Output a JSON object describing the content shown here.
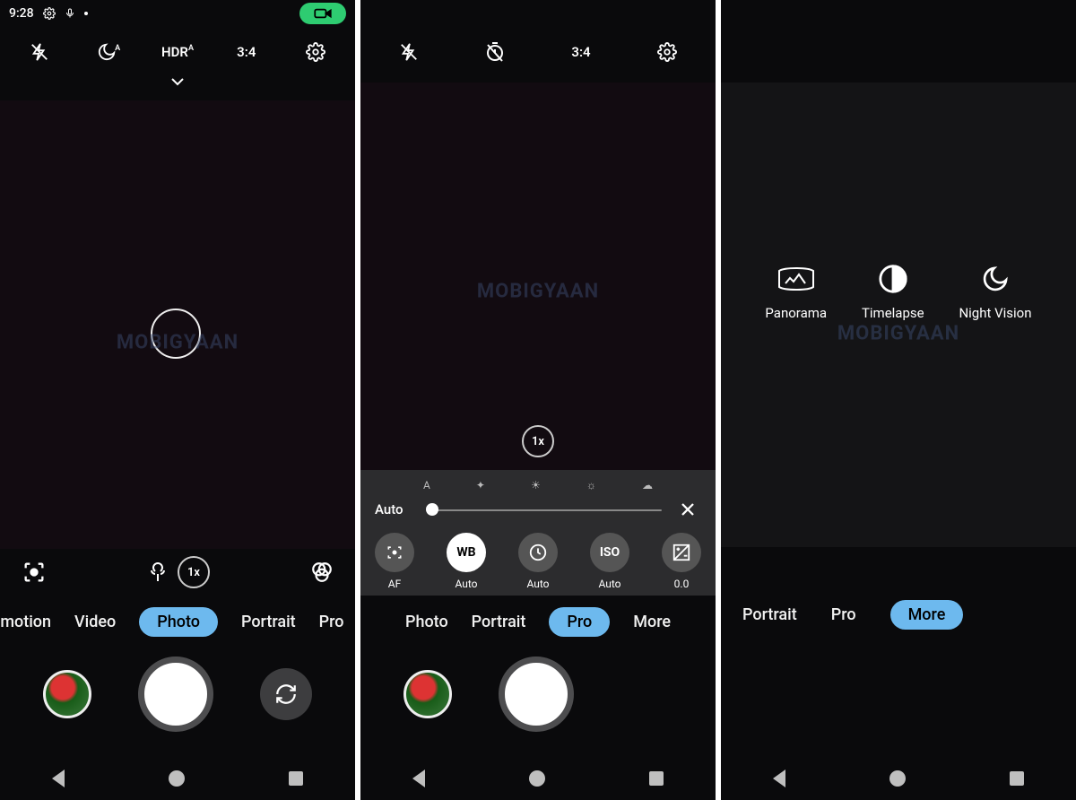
{
  "status": {
    "time": "9:28"
  },
  "colors": {
    "accent": "#6db9ee",
    "record": "#2ecc71"
  },
  "panel1": {
    "toolbar": {
      "hdr": "HDR",
      "ratio": "3:4"
    },
    "zoom": "1x",
    "watermark": "MOBIGYAAN",
    "modes": [
      {
        "label": "w motion",
        "active": false
      },
      {
        "label": "Video",
        "active": false
      },
      {
        "label": "Photo",
        "active": true
      },
      {
        "label": "Portrait",
        "active": false
      },
      {
        "label": "Pro",
        "active": false
      }
    ]
  },
  "panel2": {
    "toolbar": {
      "ratio": "3:4"
    },
    "zoom": "1x",
    "watermark": "MOBIGYAAN",
    "slider": {
      "label": "Auto",
      "ticks": [
        "A",
        "✦",
        "☀",
        "☼",
        "☁"
      ]
    },
    "controls": [
      {
        "key": "af",
        "label": "AF",
        "sub": "AF",
        "icon": "focus",
        "active": false
      },
      {
        "key": "wb",
        "label": "WB",
        "sub": "Auto",
        "icon": "wb",
        "active": true
      },
      {
        "key": "shutter",
        "label": "⊘",
        "sub": "Auto",
        "icon": "timer",
        "active": false
      },
      {
        "key": "iso",
        "label": "ISO",
        "sub": "Auto",
        "icon": "iso",
        "active": false
      },
      {
        "key": "ev",
        "label": "±",
        "sub": "0.0",
        "icon": "ev",
        "active": false
      }
    ],
    "modes": [
      {
        "label": "Photo",
        "active": false
      },
      {
        "label": "Portrait",
        "active": false
      },
      {
        "label": "Pro",
        "active": true
      },
      {
        "label": "More",
        "active": false
      }
    ]
  },
  "panel3": {
    "watermark": "MOBIGYAAN",
    "items": [
      {
        "label": "Panorama"
      },
      {
        "label": "Timelapse"
      },
      {
        "label": "Night Vision"
      }
    ],
    "modes": [
      {
        "label": "Portrait",
        "active": false
      },
      {
        "label": "Pro",
        "active": false
      },
      {
        "label": "More",
        "active": true
      }
    ]
  }
}
